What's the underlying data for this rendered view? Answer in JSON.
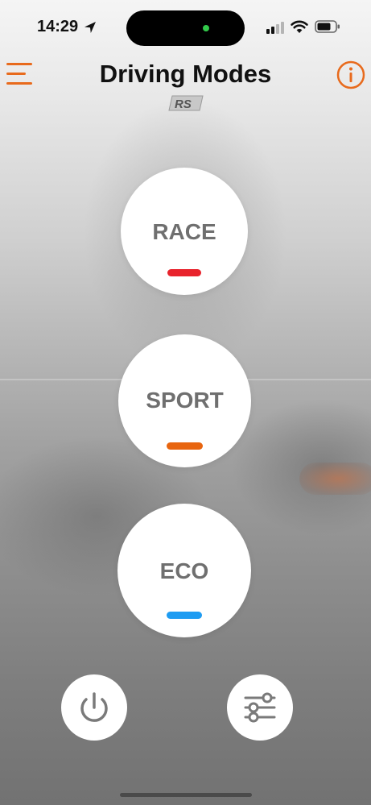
{
  "status_bar": {
    "time": "14:29",
    "icons": [
      "location-arrow-icon",
      "cellular-signal-icon",
      "wifi-icon",
      "battery-icon"
    ]
  },
  "header": {
    "title": "Driving Modes",
    "menu_icon": "hamburger-menu-icon",
    "info_icon": "info-icon",
    "logo": "RS"
  },
  "modes": [
    {
      "label": "RACE",
      "indicator_color": "#e8232c"
    },
    {
      "label": "SPORT",
      "indicator_color": "#e8650f"
    },
    {
      "label": "ECO",
      "indicator_color": "#1e9cf2"
    }
  ],
  "bottom_controls": {
    "power_icon": "power-icon",
    "settings_icon": "sliders-icon"
  },
  "colors": {
    "accent": "#e86a1c",
    "mode_text": "#6f6f6f"
  }
}
